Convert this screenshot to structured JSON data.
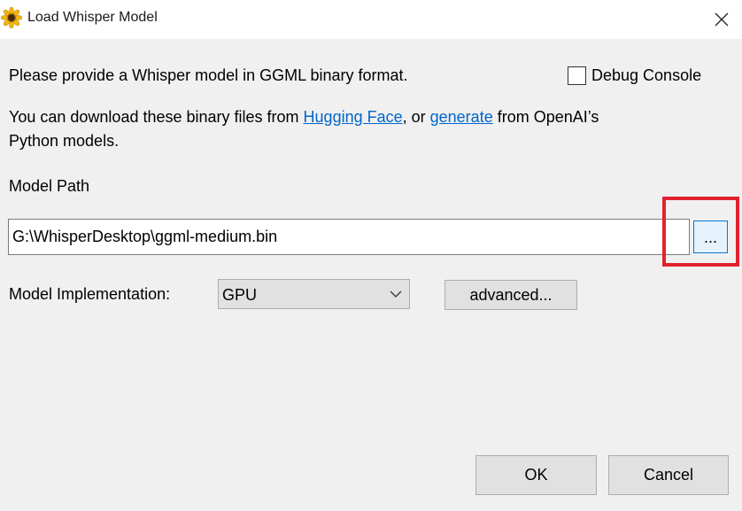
{
  "window": {
    "title": "Load Whisper Model",
    "app_icon": "sunflower-icon",
    "close_icon": "close-icon"
  },
  "main": {
    "intro_text": "Please provide a Whisper model in GGML binary format.",
    "debug_console": {
      "label": "Debug Console",
      "checked": false
    },
    "download_prefix": "You can download these binary files from ",
    "hugging_face_link": "Hugging Face",
    "download_middle": ", or ",
    "generate_link": "generate",
    "download_suffix": " from OpenAI’s",
    "download_line2": "Python models.",
    "model_path_label": "Model Path",
    "model_path_value": "G:\\WhisperDesktop\\ggml-medium.bin",
    "browse_label": "...",
    "implementation_label": "Model Implementation:",
    "implementation_value": "GPU",
    "advanced_label": "advanced..."
  },
  "footer": {
    "ok_label": "OK",
    "cancel_label": "Cancel"
  },
  "colors": {
    "link": "#0066cc",
    "highlight": "#e0232e",
    "focus_border": "#0078d7"
  }
}
